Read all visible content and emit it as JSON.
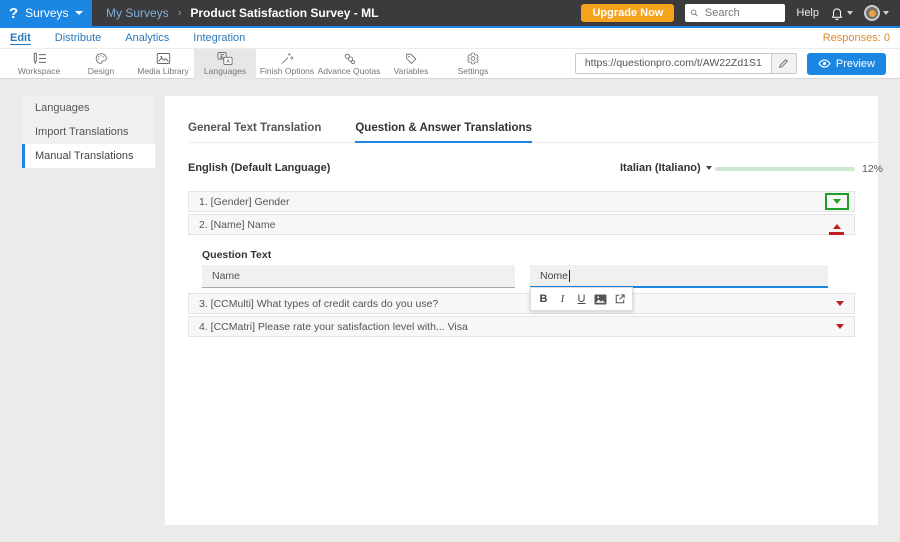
{
  "header": {
    "logo_glyph": "?",
    "product_menu_label": "Surveys",
    "breadcrumb": {
      "parent": "My Surveys",
      "separator": "›",
      "current": "Product Satisfaction Survey - ML"
    },
    "upgrade_button": "Upgrade Now",
    "search_placeholder": "Search",
    "help_label": "Help"
  },
  "nav": {
    "items": [
      "Edit",
      "Distribute",
      "Analytics",
      "Integration"
    ],
    "active_item": "Edit",
    "responses_label": "Responses: 0"
  },
  "toolbar": {
    "items": [
      "Workspace",
      "Design",
      "Media Library",
      "Languages",
      "Finish Options",
      "Advance Quotas",
      "Variables",
      "Settings"
    ],
    "active_item": "Languages",
    "survey_url": "https://questionpro.com/t/AW22Zd1S1",
    "preview_label": "Preview"
  },
  "sidebar": {
    "items": [
      "Languages",
      "Import Translations",
      "Manual Translations"
    ],
    "active_item": "Manual Translations"
  },
  "content": {
    "tabs": [
      "General Text Translation",
      "Question & Answer Translations"
    ],
    "active_tab": "Question & Answer Translations",
    "source_language": "English (Default Language)",
    "target_language": "Italian (Italiano)",
    "progress_percent_label": "12%",
    "progress_value": 12,
    "questions": [
      {
        "label": "1. [Gender] Gender",
        "state": "collapsed-highlighted"
      },
      {
        "label": "2. [Name] Name",
        "state": "expanded"
      },
      {
        "label": "3. [CCMulti] What types of credit cards do you use?",
        "state": "collapsed"
      },
      {
        "label": "4. [CCMatri] Please rate your satisfaction level with... Visa",
        "state": "collapsed"
      }
    ],
    "editor": {
      "section_label": "Question Text",
      "source_text": "Name",
      "translation_text": "Nome"
    },
    "format_toolbar": {
      "bold": "B",
      "italic": "I",
      "underline": "U"
    }
  },
  "colors": {
    "accent_blue": "#1c86e3",
    "header_dark": "#3b3b3d",
    "upgrade_orange": "#f5a21d",
    "progress_green": "#3f9e3f",
    "caret_red": "#c11f1f",
    "caret_green": "#27a22b"
  }
}
